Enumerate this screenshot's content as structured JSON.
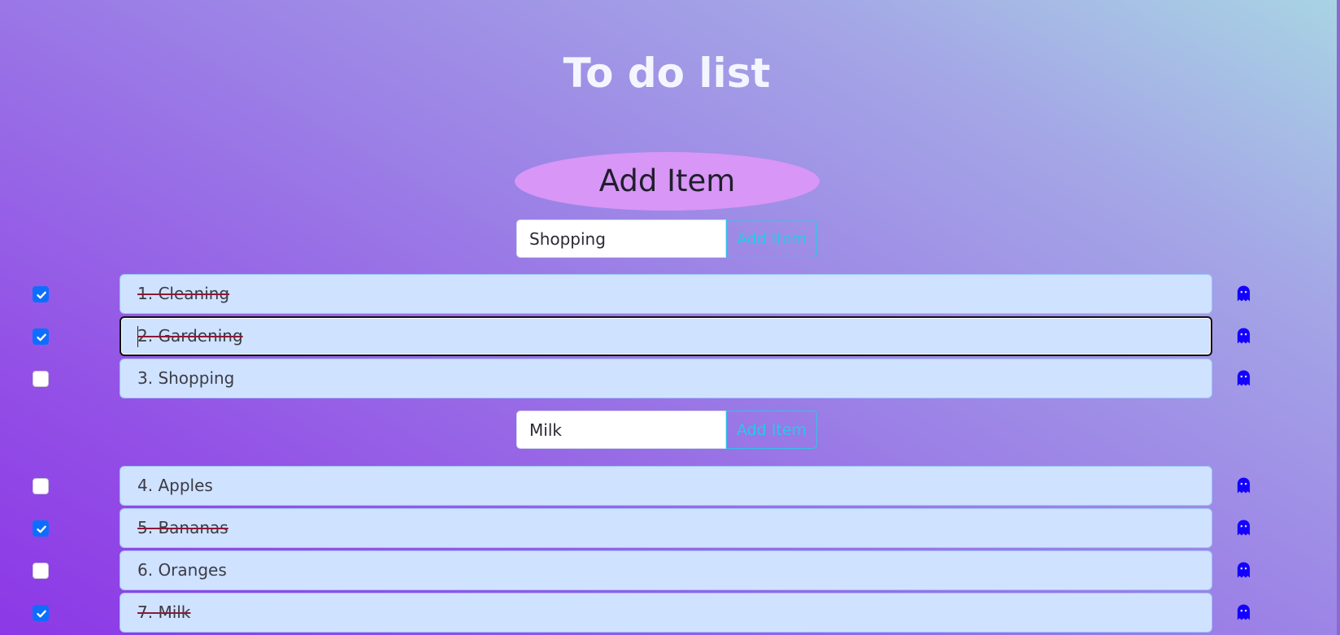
{
  "title": "To do list",
  "add_heading": "Add Item",
  "groups": [
    {
      "input_value": "Shopping",
      "button_label": "Add Item",
      "items": [
        {
          "text": "1. Cleaning",
          "checked": true
        },
        {
          "text": "2. Gardening",
          "checked": true,
          "focused": true
        },
        {
          "text": "3. Shopping",
          "checked": false
        }
      ]
    },
    {
      "input_value": "Milk",
      "button_label": "Add Item",
      "items": [
        {
          "text": "4. Apples",
          "checked": false
        },
        {
          "text": "5. Bananas",
          "checked": true
        },
        {
          "text": "6. Oranges",
          "checked": false
        },
        {
          "text": "7. Milk",
          "checked": true
        }
      ]
    }
  ],
  "delete_icon": "ghost-icon",
  "colors": {
    "checkbox_checked": "#0d6efd",
    "item_bg": "#cfe2ff",
    "add_button": "#2cc6e8",
    "add_pill": "#d896f6",
    "ghost_icon": "#1400ff"
  }
}
